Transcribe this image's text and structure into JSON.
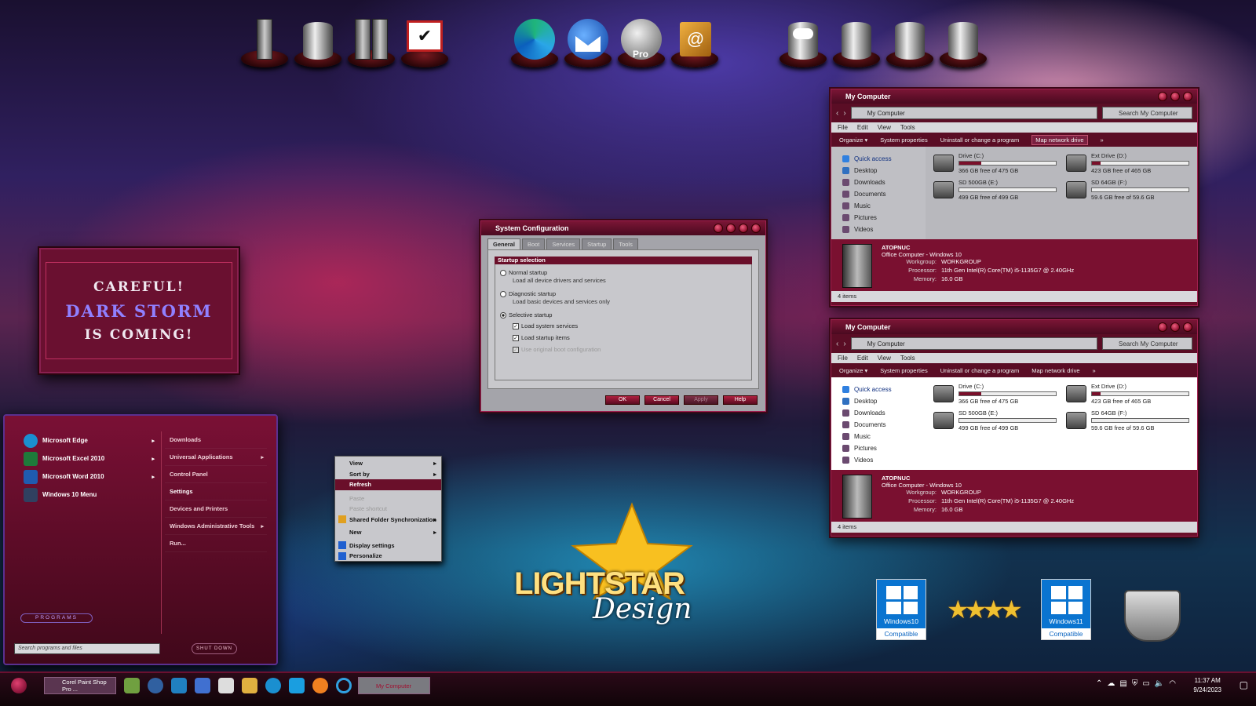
{
  "storm": {
    "line1": "CAREFUL!",
    "line2": "DARK STORM",
    "line3": "IS COMING!"
  },
  "dock": {
    "group1": [
      "server-tower-icon",
      "hard-drive-icon",
      "server-towers-icon",
      "task-checklist-icon"
    ],
    "group2": [
      "edge-browser-icon",
      "thunderbird-mail-icon",
      "google-earth-pro-icon",
      "address-book-icon"
    ],
    "group3": [
      "cloud-drive-icon",
      "hard-drive-icon",
      "hard-drive-icon",
      "hard-drive-icon"
    ],
    "earth_label": "Pro"
  },
  "mycomputer": {
    "title": "My Computer",
    "address": "My Computer",
    "search_placeholder": "Search My Computer",
    "menu": [
      "File",
      "Edit",
      "View",
      "Tools"
    ],
    "commands": [
      "Organize ▾",
      "System properties",
      "Uninstall or change a program",
      "Map network drive",
      "»"
    ],
    "nav": [
      "Quick access",
      "Desktop",
      "Downloads",
      "Documents",
      "Music",
      "Pictures",
      "Videos"
    ],
    "drives": [
      {
        "name": "Drive (C:)",
        "free": "366 GB free of 475 GB",
        "used_fraction": 0.23
      },
      {
        "name": "Ext Drive (D:)",
        "free": "423 GB free of 465 GB",
        "used_fraction": 0.09
      },
      {
        "name": "SD 500GB (E:)",
        "free": "499 GB free of 499 GB",
        "used_fraction": 0.0
      },
      {
        "name": "SD 64GB (F:)",
        "free": "59.6 GB free of 59.6 GB",
        "used_fraction": 0.0
      }
    ],
    "computer_name": "ATOPNUC",
    "computer_desc": "Office Computer - Windows 10",
    "details": [
      {
        "k": "Workgroup:",
        "v": "WORKGROUP"
      },
      {
        "k": "Processor:",
        "v": "11th Gen Intel(R) Core(TM) i5-1135G7 @ 2.40GHz"
      },
      {
        "k": "Memory:",
        "v": "16.0 GB"
      }
    ],
    "status": "4 items"
  },
  "syscfg": {
    "title": "System Configuration",
    "tabs": [
      "General",
      "Boot",
      "Services",
      "Startup",
      "Tools"
    ],
    "group_title": "Startup selection",
    "normal": "Normal startup",
    "normal_desc": "Load all device drivers and services",
    "diagnostic": "Diagnostic startup",
    "diagnostic_desc": "Load basic devices and services only",
    "selective": "Selective startup",
    "load_system": "Load system services",
    "load_startup": "Load startup items",
    "use_original": "Use original boot configuration",
    "buttons": [
      "OK",
      "Cancel",
      "Apply",
      "Help"
    ]
  },
  "startmenu": {
    "left": [
      {
        "label": "Microsoft Edge",
        "color": "#1a8fd0"
      },
      {
        "label": "Microsoft Excel 2010",
        "color": "#1e7a3a"
      },
      {
        "label": "Microsoft Word 2010",
        "color": "#1f5bb0"
      },
      {
        "label": "Windows 10 Menu",
        "color": "#304060"
      }
    ],
    "right": [
      "Downloads",
      "Universal Applications",
      "Control Panel",
      "Settings",
      "Devices and Printers",
      "Windows Administrative Tools",
      "Run..."
    ],
    "programs": "PROGRAMS",
    "search_placeholder": "Search programs and files",
    "shutdown": "SHUT DOWN"
  },
  "context": {
    "items": [
      "View",
      "Sort by",
      "Refresh",
      "Paste",
      "Paste shortcut",
      "Shared Folder Synchronization",
      "New",
      "Display settings",
      "Personalize"
    ]
  },
  "logo": {
    "text1": "LIGHTSTAR",
    "text2": "Design"
  },
  "badges": {
    "win10": "Windows10",
    "win11": "Windows11",
    "compatible": "Compatible"
  },
  "taskbar": {
    "task1": "Corel Paint Shop Pro ...",
    "task2": "My Computer",
    "time": "11:37 AM",
    "date": "9/24/2023"
  }
}
